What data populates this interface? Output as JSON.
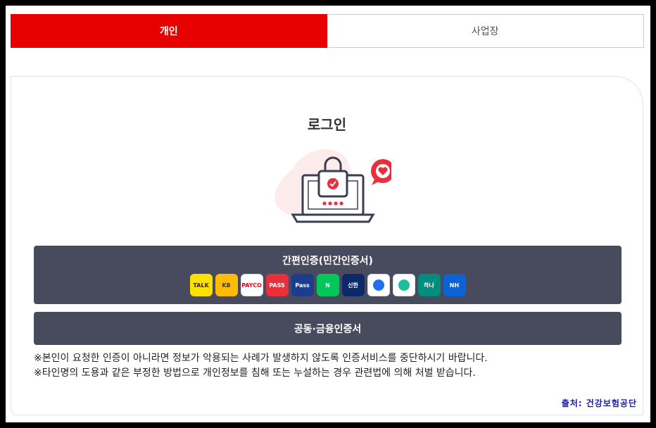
{
  "tabs": [
    {
      "label": "개인",
      "active": true
    },
    {
      "label": "사업장",
      "active": false
    }
  ],
  "login": {
    "title": "로그인",
    "simple_auth_label": "간편인증(민간인증서)",
    "cert_auth_label": "공동·금융인증서"
  },
  "apps": [
    {
      "name": "kakaotalk-icon",
      "text": "TALK",
      "bg": "#fae100",
      "fg": "#3c1e1e"
    },
    {
      "name": "kb-icon",
      "text": "KB",
      "bg": "#ffbc00",
      "fg": "#3b3b3b"
    },
    {
      "name": "payco-icon",
      "text": "PAYCO",
      "bg": "#ffffff",
      "fg": "#e30a17"
    },
    {
      "name": "pass-icon",
      "text": "PASS",
      "bg": "#e8303d",
      "fg": "#ffffff"
    },
    {
      "name": "samsung-pass-icon",
      "text": "Pass",
      "bg": "#1c3c8c",
      "fg": "#ffffff"
    },
    {
      "name": "naver-icon",
      "text": "N",
      "bg": "#03c75a",
      "fg": "#ffffff"
    },
    {
      "name": "shinhan-icon",
      "text": "신한",
      "bg": "#0a2a6b",
      "fg": "#ffffff"
    },
    {
      "name": "toss-icon",
      "text": "",
      "bg": "#ffffff",
      "fg": "#1f6ff0"
    },
    {
      "name": "banksalad-icon",
      "text": "",
      "bg": "#ffffff",
      "fg": "#1fbf99"
    },
    {
      "name": "hana-icon",
      "text": "하나",
      "bg": "#008c7e",
      "fg": "#ffffff"
    },
    {
      "name": "nh-icon",
      "text": "NH",
      "bg": "#0b63d6",
      "fg": "#ffffff"
    }
  ],
  "notices": [
    "※본인이 요청한 인증이 아니라면 정보가 악용되는 사례가 발생하지 않도록 인증서비스를 중단하시기 바랍니다.",
    "※타인명의 도용과 같은 부정한 방법으로 개인정보를 침해 또는 누설하는 경우 관련법에 의해 처벌 받습니다."
  ],
  "source": "출처: 건강보험공단",
  "colors": {
    "accent": "#e60000",
    "button": "#484a5e",
    "source_text": "#1a1aa6"
  }
}
